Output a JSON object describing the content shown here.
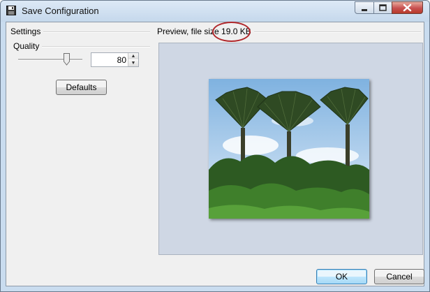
{
  "window": {
    "title": "Save Configuration",
    "controls": {
      "minimize": "—",
      "maximize": "□",
      "close": "✕"
    }
  },
  "settings": {
    "group_label": "Settings",
    "quality_label": "Quality",
    "quality_value": "80",
    "defaults_button": "Defaults"
  },
  "preview": {
    "label": "Preview, file size",
    "file_size": "19.0 KB",
    "image_subject": "palm-trees-photo"
  },
  "footer": {
    "ok_button": "OK",
    "cancel_button": "Cancel"
  },
  "colors": {
    "annotation": "#b0272b",
    "preview_bg": "#cfd7e4",
    "default_button_border": "#3c7fb1"
  }
}
